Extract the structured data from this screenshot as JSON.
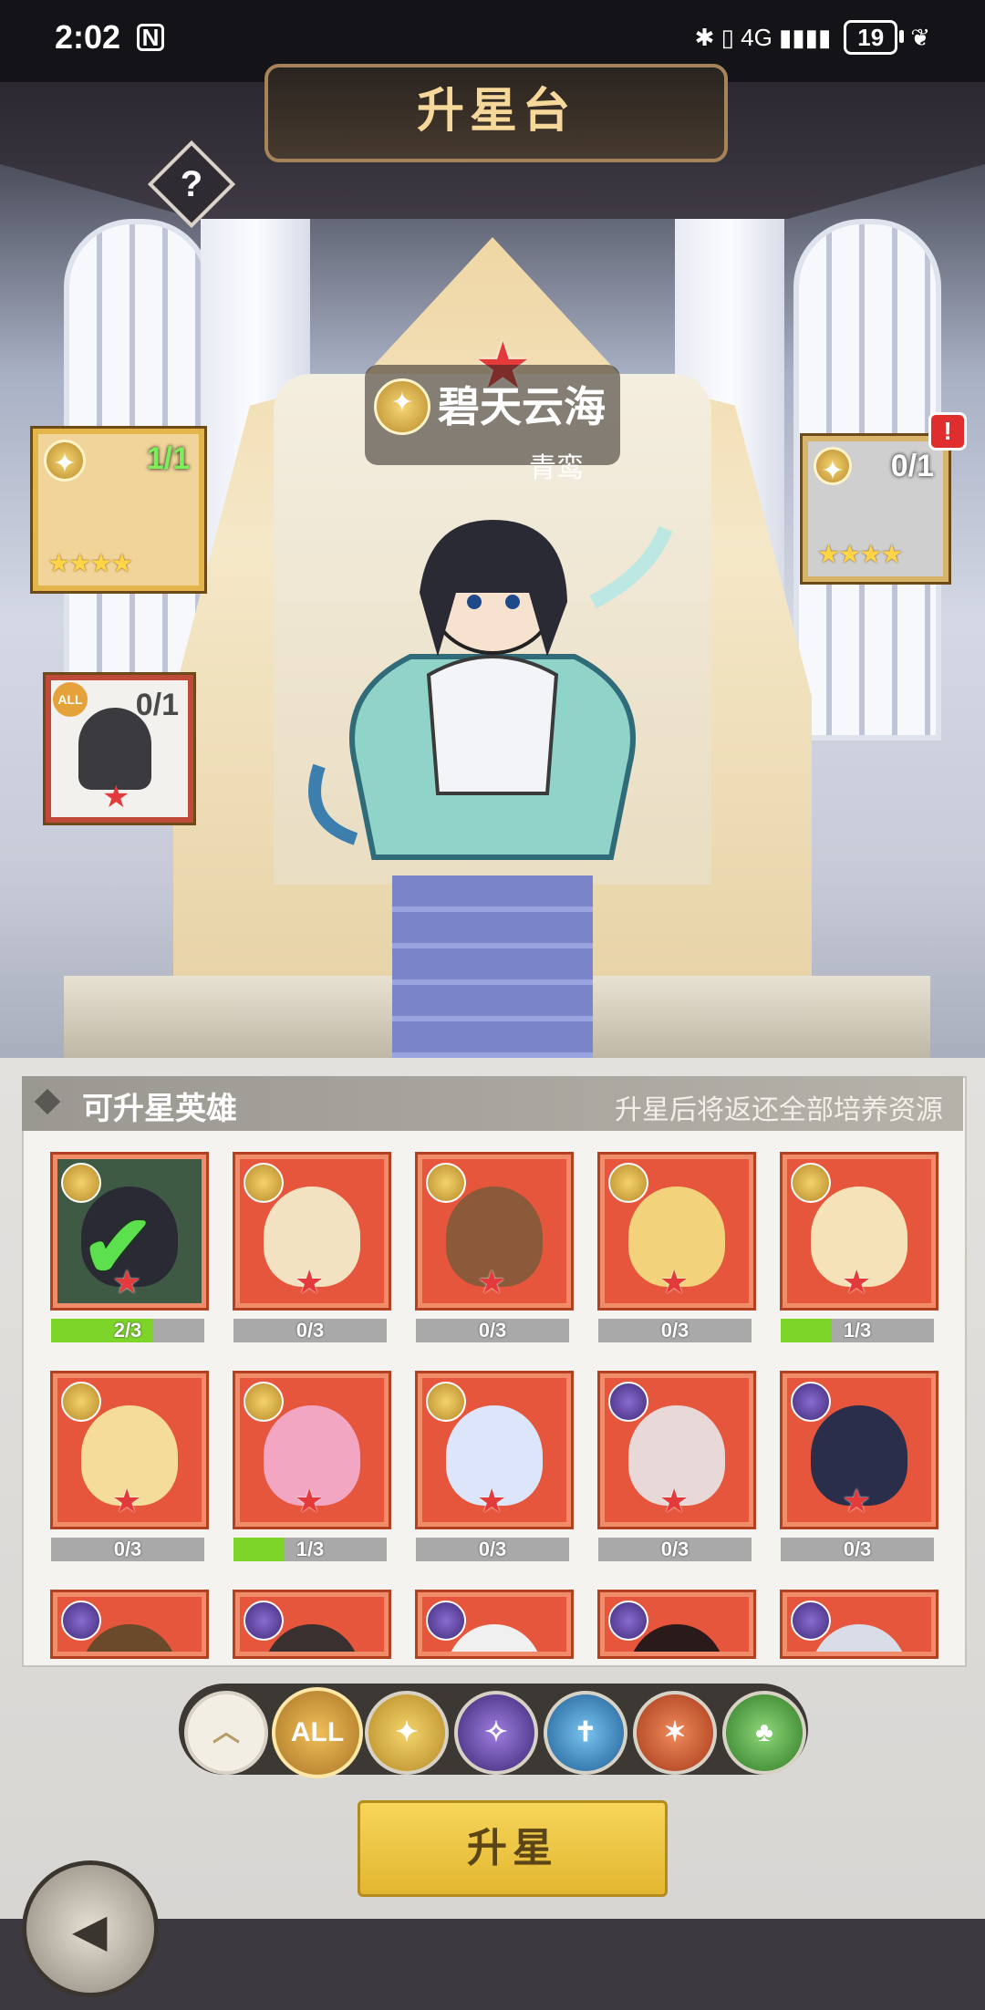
{
  "status_bar": {
    "time": "2:02",
    "nfc": "N",
    "icons": "✱ ▯ 4G ▮▮▮▮",
    "battery": "19"
  },
  "scene": {
    "title": "升星台",
    "help": "?",
    "hero_name": "碧天云海",
    "hero_subname": "青鸾",
    "slot_left_count": "1/1",
    "slot_left_stars": "★★★★",
    "slot_right_count": "0/1",
    "slot_right_stars": "★★★★",
    "slot_helm_badge": "ALL",
    "slot_helm_count": "0/1",
    "alert": "!"
  },
  "panel": {
    "title": "可升星英雄",
    "note": "升星后将返还全部培养资源"
  },
  "cards": [
    {
      "progress": "2/3",
      "fill": 0.667,
      "badge": "gold",
      "selected": true,
      "color": "#2a2a35"
    },
    {
      "progress": "0/3",
      "fill": 0,
      "badge": "gold",
      "color": "#f3e2c2"
    },
    {
      "progress": "0/3",
      "fill": 0,
      "badge": "gold",
      "color": "#8a5a3a"
    },
    {
      "progress": "0/3",
      "fill": 0,
      "badge": "gold",
      "color": "#f2d27a"
    },
    {
      "progress": "1/3",
      "fill": 0.333,
      "badge": "gold",
      "color": "#f6e2b8"
    },
    {
      "progress": "0/3",
      "fill": 0,
      "badge": "gold",
      "color": "#f5dc9a"
    },
    {
      "progress": "1/3",
      "fill": 0.333,
      "badge": "gold",
      "color": "#f3a6c2"
    },
    {
      "progress": "0/3",
      "fill": 0,
      "badge": "gold",
      "color": "#dce5fa"
    },
    {
      "progress": "0/3",
      "fill": 0,
      "badge": "purple",
      "color": "#e8d8d8"
    },
    {
      "progress": "0/3",
      "fill": 0,
      "badge": "purple",
      "color": "#2b2e4a"
    },
    {
      "badge": "purple",
      "color": "#6a4a2a"
    },
    {
      "badge": "purple",
      "color": "#3a3030"
    },
    {
      "badge": "purple",
      "color": "#f0f0f0"
    },
    {
      "badge": "purple",
      "color": "#2a1a1a"
    },
    {
      "badge": "purple",
      "color": "#d8dde8"
    }
  ],
  "filters": {
    "up": "︿",
    "all": "ALL",
    "f1": "✦",
    "f2": "✧",
    "f3": "✝",
    "f4": "✶",
    "f5": "♣"
  },
  "action": {
    "star_up": "升星",
    "back": "◂"
  }
}
